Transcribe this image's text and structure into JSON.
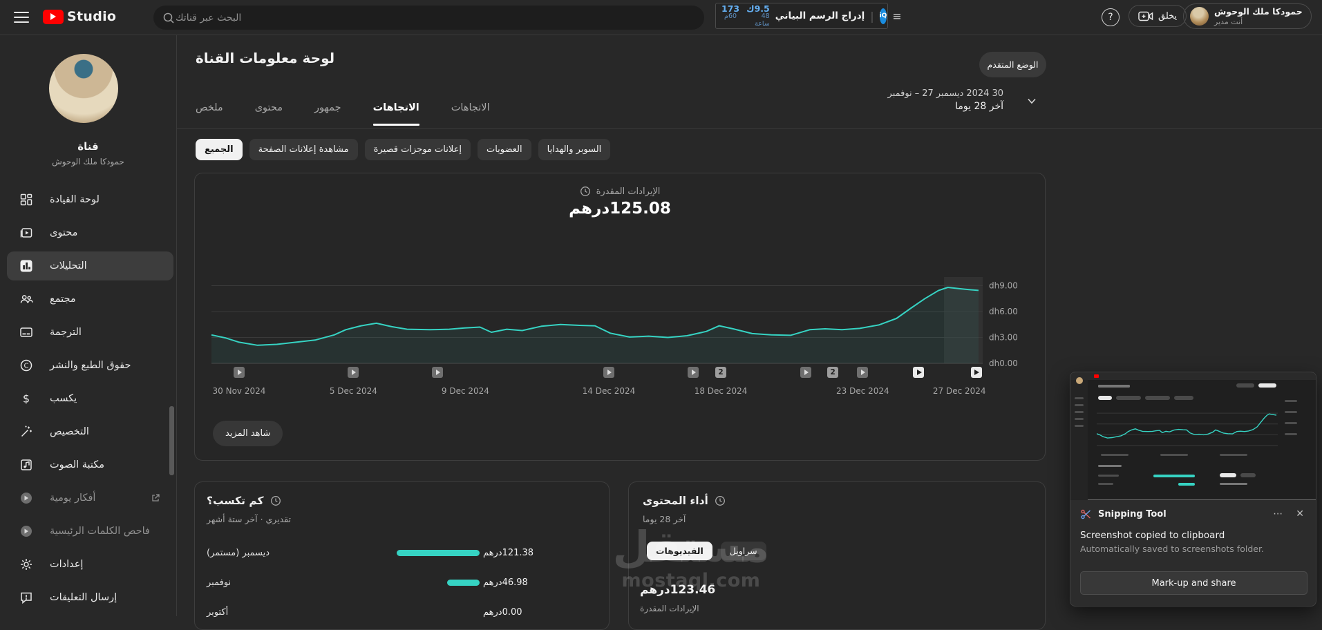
{
  "topbar": {
    "logo_text": "Studio",
    "search_placeholder": "البحث عبر قناتك",
    "vidiq": {
      "stats": [
        {
          "value": "173",
          "sub": "60م"
        },
        {
          "value": "9.5ك",
          "sub": "48 ساعة"
        }
      ],
      "insert_chart_label": "إدراج الرسم البياني"
    },
    "create_label": "يخلق",
    "account_name": "حمودكا ملك الوحوش",
    "account_role": "أنت مدير"
  },
  "sidebar": {
    "channel_label": "قناة",
    "channel_name": "حمودكا ملك الوحوش",
    "items": [
      {
        "label": "لوحة القيادة",
        "icon": "dashboard"
      },
      {
        "label": "محتوى",
        "icon": "content"
      },
      {
        "label": "التحليلات",
        "icon": "analytics",
        "selected": true
      },
      {
        "label": "مجتمع",
        "icon": "community"
      },
      {
        "label": "الترجمة",
        "icon": "subtitles"
      },
      {
        "label": "حقوق الطبع والنشر",
        "icon": "copyright"
      },
      {
        "label": "يكسب",
        "icon": "earn"
      },
      {
        "label": "التخصيص",
        "icon": "customization"
      },
      {
        "label": "مكتبة الصوت",
        "icon": "audio-library"
      },
      {
        "label": "أفكار يومية",
        "icon": "vidiq",
        "dim": true,
        "external": true
      },
      {
        "label": "فاحص الكلمات الرئيسية",
        "icon": "vidiq",
        "dim": true
      },
      {
        "label": "إعدادات",
        "icon": "settings"
      },
      {
        "label": "إرسال التعليقات",
        "icon": "feedback"
      }
    ]
  },
  "header": {
    "title": "لوحة معلومات القناة",
    "advanced_mode_label": "الوضع المتقدم",
    "date_range_tokens": [
      "نوفمبر",
      "–",
      "27",
      "ديسمبر",
      "2024",
      "30"
    ],
    "date_range_sub": "آخر 28 يوما",
    "tabs": [
      {
        "label": "ملخص"
      },
      {
        "label": "محتوى"
      },
      {
        "label": "جمهور"
      },
      {
        "label": "الاتجاهات",
        "selected": true
      },
      {
        "label": "الاتجاهات"
      }
    ],
    "filter_chips": [
      {
        "label": "الجميع",
        "selected": true
      },
      {
        "label": "مشاهدة إعلانات الصفحة"
      },
      {
        "label": "إعلانات موجزات قصيرة"
      },
      {
        "label": "العضويات"
      },
      {
        "label": "السوبر والهدايا"
      }
    ]
  },
  "chart_data": {
    "type": "line",
    "title": "الإيرادات المقدرة",
    "total_currency": "درهم",
    "total_amount": "125.08",
    "line_color": "#36d3c3",
    "grid": true,
    "legend": "none",
    "ylim": [
      0,
      9.6
    ],
    "yticks": [
      {
        "label": "dh9.00",
        "value": 9
      },
      {
        "label": "dh6.00",
        "value": 6
      },
      {
        "label": "dh3.00",
        "value": 3
      },
      {
        "label": "dh0.00",
        "value": 0
      }
    ],
    "x_dates": [
      {
        "label": "30 Nov 2024",
        "pos": 0.036
      },
      {
        "label": "5 Dec 2024",
        "pos": 0.185
      },
      {
        "label": "9 Dec 2024",
        "pos": 0.331
      },
      {
        "label": "14 Dec 2024",
        "pos": 0.518
      },
      {
        "label": "18 Dec 2024",
        "pos": 0.664
      },
      {
        "label": "23 Dec 2024",
        "pos": 0.849
      },
      {
        "label": "27 Dec 2024",
        "pos": 0.975
      }
    ],
    "points": [
      [
        0.0,
        3.3
      ],
      [
        0.018,
        2.95
      ],
      [
        0.036,
        2.45
      ],
      [
        0.06,
        2.1
      ],
      [
        0.085,
        2.2
      ],
      [
        0.11,
        2.45
      ],
      [
        0.135,
        2.7
      ],
      [
        0.16,
        3.3
      ],
      [
        0.175,
        3.9
      ],
      [
        0.195,
        4.35
      ],
      [
        0.215,
        4.65
      ],
      [
        0.235,
        4.25
      ],
      [
        0.255,
        3.95
      ],
      [
        0.285,
        3.9
      ],
      [
        0.31,
        3.95
      ],
      [
        0.33,
        4.1
      ],
      [
        0.35,
        4.2
      ],
      [
        0.365,
        3.6
      ],
      [
        0.385,
        3.95
      ],
      [
        0.405,
        3.8
      ],
      [
        0.43,
        4.3
      ],
      [
        0.455,
        4.5
      ],
      [
        0.48,
        4.4
      ],
      [
        0.5,
        4.35
      ],
      [
        0.52,
        3.5
      ],
      [
        0.545,
        3.05
      ],
      [
        0.57,
        3.15
      ],
      [
        0.595,
        3.0
      ],
      [
        0.62,
        3.2
      ],
      [
        0.645,
        3.7
      ],
      [
        0.662,
        4.35
      ],
      [
        0.68,
        4.0
      ],
      [
        0.705,
        3.45
      ],
      [
        0.73,
        3.3
      ],
      [
        0.755,
        3.25
      ],
      [
        0.78,
        3.9
      ],
      [
        0.8,
        4.0
      ],
      [
        0.822,
        3.9
      ],
      [
        0.845,
        4.05
      ],
      [
        0.87,
        4.45
      ],
      [
        0.893,
        5.2
      ],
      [
        0.912,
        6.4
      ],
      [
        0.93,
        7.5
      ],
      [
        0.948,
        8.45
      ],
      [
        0.96,
        8.8
      ],
      [
        0.975,
        8.65
      ],
      [
        0.99,
        8.52
      ],
      [
        1.0,
        8.45
      ]
    ],
    "incomplete_region_start": 0.955,
    "publish_markers": [
      {
        "pos": 0.036,
        "type": "video"
      },
      {
        "pos": 0.185,
        "type": "video"
      },
      {
        "pos": 0.295,
        "type": "video"
      },
      {
        "pos": 0.518,
        "type": "video"
      },
      {
        "pos": 0.628,
        "type": "video"
      },
      {
        "pos": 0.664,
        "type": "badge",
        "label": "2"
      },
      {
        "pos": 0.775,
        "type": "video"
      },
      {
        "pos": 0.81,
        "type": "badge",
        "label": "2"
      },
      {
        "pos": 0.849,
        "type": "video"
      },
      {
        "pos": 0.922,
        "type": "play"
      },
      {
        "pos": 0.997,
        "type": "play"
      }
    ],
    "see_more_label": "شاهد المزيد"
  },
  "earnings_card": {
    "title": "كم تكسب؟",
    "subtitle": "تقديري · آخر ستة أشهر",
    "bar_scale_max": 125,
    "rows": [
      {
        "label": "ديسمبر (مستمر)",
        "currency": "درهم",
        "amount": "121.38",
        "bar": 121.38
      },
      {
        "label": "نوفمبر",
        "currency": "درهم",
        "amount": " 46.98",
        "bar": 46.98
      },
      {
        "label": "أكتوبر",
        "currency": "درهم",
        "amount": "0.00",
        "bar": 0
      }
    ]
  },
  "content_card": {
    "title": "أداء المحتوى",
    "subtitle": "آخر 28 يوما",
    "chips": [
      {
        "label": "الفيديوهات",
        "selected": true
      },
      {
        "label": "سراويل"
      }
    ],
    "metric_currency": "درهم",
    "metric_amount": "123.46",
    "metric_label": "الإيرادات المقدرة"
  },
  "watermark": {
    "line1": "مستقل",
    "line2": "mostaql.com"
  },
  "snipping_tool": {
    "app_name": "Snipping Tool",
    "more_glyph": "⋯",
    "close_glyph": "✕",
    "message_title": "Screenshot copied to clipboard",
    "message_sub": "Automatically saved to screenshots folder.",
    "action_label": "Mark-up and share"
  },
  "colors": {
    "accent_teal": "#36d3c3",
    "vidiq_blue": "#64aef0"
  }
}
